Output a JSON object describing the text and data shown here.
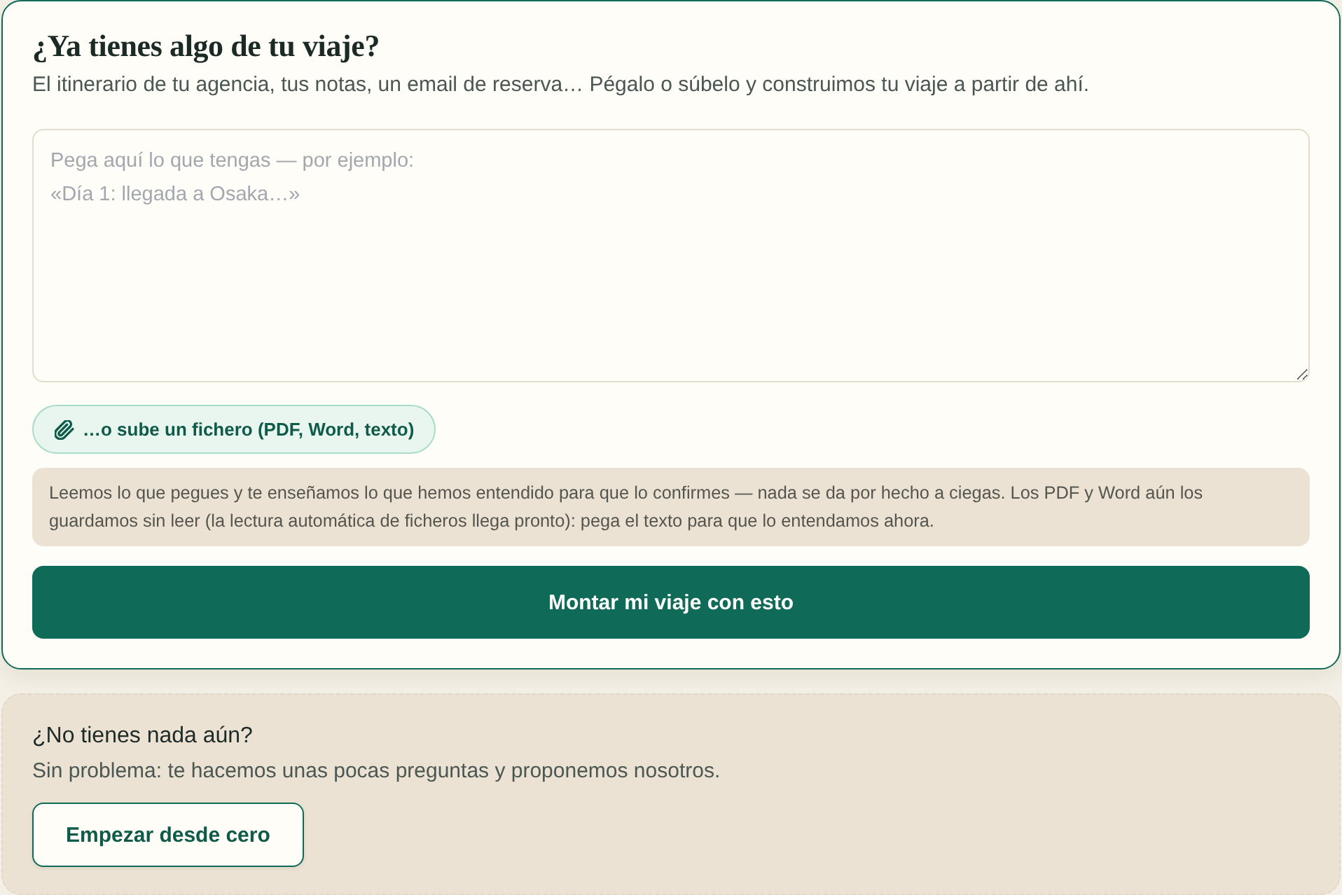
{
  "import_card": {
    "title": "¿Ya tienes algo de tu viaje?",
    "subtitle": "El itinerario de tu agencia, tus notas, un email de reserva… Pégalo o súbelo y construimos tu viaje a partir de ahí.",
    "paste_field": {
      "placeholder": "Pega aquí lo que tengas — por ejemplo:\n«Día 1: llegada a Osaka…»"
    },
    "upload_button": {
      "label": "…o sube un fichero (PDF, Word, texto)"
    },
    "note": "Leemos lo que pegues y te enseñamos lo que hemos entendido para que lo confirmes — nada se da por hecho a ciegas. Los PDF y Word aún los guardamos sin leer (la lectura automática de ficheros llega pronto): pega el texto para que lo entendamos ahora.",
    "submit_button": {
      "label": "Montar mi viaje con esto"
    }
  },
  "start_card": {
    "title": "¿No tienes nada aún?",
    "subtitle": "Sin problema: te hacemos unas pocas preguntas y proponemos nosotros.",
    "button": {
      "label": "Empezar desde cero"
    }
  }
}
